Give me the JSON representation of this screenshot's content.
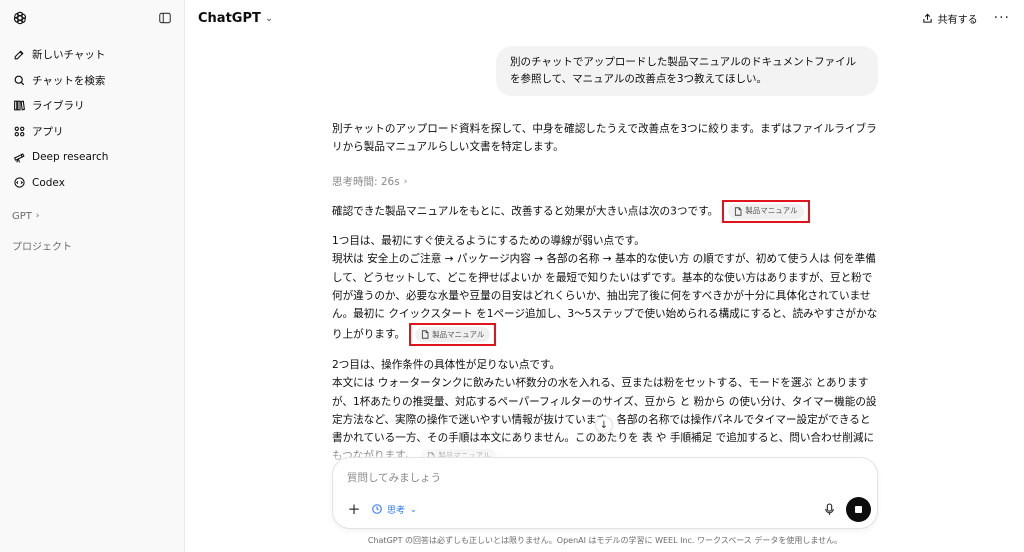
{
  "sidebar": {
    "items": [
      {
        "label": "新しいチャット",
        "icon": "new-chat-icon"
      },
      {
        "label": "チャットを検索",
        "icon": "search-icon"
      },
      {
        "label": "ライブラリ",
        "icon": "library-icon"
      },
      {
        "label": "アプリ",
        "icon": "apps-icon"
      },
      {
        "label": "Deep research",
        "icon": "telescope-icon"
      },
      {
        "label": "Codex",
        "icon": "codex-icon"
      }
    ],
    "gpt_section": "GPT",
    "projects_label": "プロジェクト"
  },
  "header": {
    "model": "ChatGPT",
    "share_label": "共有する",
    "more_label": "···"
  },
  "chat": {
    "user_message": "別のチャットでアップロードした製品マニュアルのドキュメントファイルを参照して、マニュアルの改善点を3つ教えてほしい。",
    "intro": "別チャットのアップロード資料を探して、中身を確認したうえで改善点を3つに絞ります。まずはファイルライブラリから製品マニュアルらしい文書を特定します。",
    "thinking": "思考時間: 26s",
    "summary": "確認できた製品マニュアルをもとに、改善すると効果が大きい点は次の3つです。",
    "source_chip": "製品マニュアル",
    "point1_heading": "1つ目は、最初にすぐ使えるようにするための導線が弱い点です。",
    "point1_body": "現状は 安全上のご注意 → パッケージ内容 → 各部の名称 → 基本的な使い方 の順ですが、初めて使う人は 何を準備して、どうセットして、どこを押せばよいか を最短で知りたいはずです。基本的な使い方はありますが、豆と粉で何が違うのか、必要な水量や豆量の目安はどれくらいか、抽出完了後に何をすべきかが十分に具体化されていません。最初に クイックスタート を1ページ追加し、3〜5ステップで使い始められる構成にすると、読みやすさがかなり上がります。",
    "point2_heading": "2つ目は、操作条件の具体性が足りない点です。",
    "point2_body": "本文には ウォータータンクに飲みたい杯数分の水を入れる、豆または粉をセットする、モードを選ぶ とありますが、1杯あたりの推奨量、対応するペーパーフィルターのサイズ、豆から と 粉から の使い分け、タイマー機能の設定方法など、実際の操作で迷いやすい情報が抜けています。各部の名称では操作パネルでタイマー設定ができると書かれている一方、その手順は本文にありません。このあたりを 表 や 手順補足 で追加すると、問い合わせ削減にもつながります。"
  },
  "composer": {
    "placeholder": "質問してみましょう",
    "think_label": "思考"
  },
  "footer": "ChatGPT の回答は必ずしも正しいとは限りません。OpenAI はモデルの学習に WEEL Inc. ワークスペース データを使用しません。"
}
